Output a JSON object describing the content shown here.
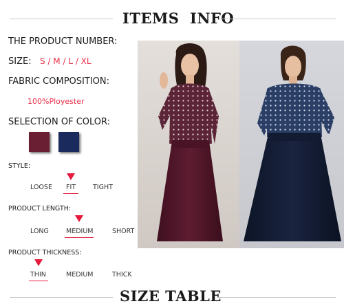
{
  "header": {
    "title": "ITEMS  INFO"
  },
  "footer": {
    "title": "SIZE TABLE"
  },
  "specs": {
    "product_number_label": "THE PRODUCT NUMBER:",
    "size_label": "SIZE:",
    "size_value": "S / M / L / XL",
    "fabric_label": "FABRIC COMPOSITION:",
    "fabric_value": "100%Ployester",
    "color_label": "SELECTION OF COLOR:",
    "colors": [
      "#6b1f32",
      "#1b2a5c"
    ]
  },
  "style": {
    "label": "STYLE:",
    "options": [
      "LOOSE",
      "FIT",
      "TIGHT"
    ],
    "selected": "FIT"
  },
  "length": {
    "label": "PRODUCT LENGTH:",
    "options": [
      "LONG",
      "MEDIUM",
      "SHORT"
    ],
    "selected": "MEDIUM"
  },
  "thickness": {
    "label": "PRODUCT THICKNESS:",
    "options": [
      "THIN",
      "MEDIUM",
      "THICK"
    ],
    "selected": "THIN"
  },
  "accent_color": "#e51a3c"
}
